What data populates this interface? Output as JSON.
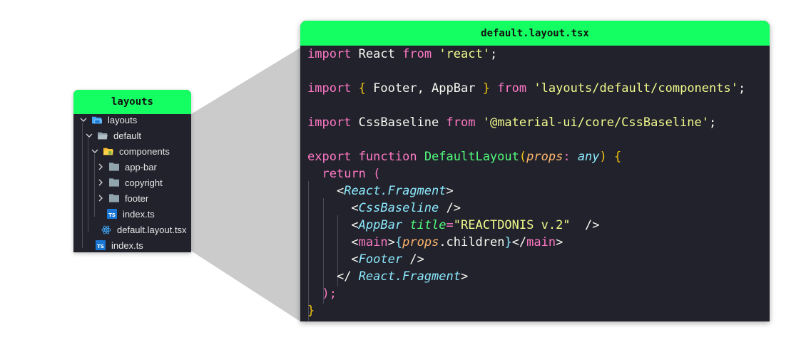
{
  "explorer": {
    "title": "layouts",
    "items": [
      {
        "label": "layouts",
        "chevron": "down",
        "icon": "folder-open-icon"
      },
      {
        "label": "default",
        "chevron": "down",
        "icon": "folder-open-icon"
      },
      {
        "label": "components",
        "chevron": "down",
        "icon": "folder-open-icon"
      },
      {
        "label": "app-bar",
        "chevron": "right",
        "icon": "folder-icon"
      },
      {
        "label": "copyright",
        "chevron": "right",
        "icon": "folder-icon"
      },
      {
        "label": "footer",
        "chevron": "right",
        "icon": "folder-icon"
      },
      {
        "label": "index.ts",
        "chevron": "none",
        "icon": "typescript-file-icon"
      },
      {
        "label": "default.layout.tsx",
        "chevron": "none",
        "icon": "react-file-icon"
      },
      {
        "label": "index.ts",
        "chevron": "none",
        "icon": "typescript-file-icon"
      }
    ]
  },
  "editor": {
    "title": "default.layout.tsx",
    "tokens": {
      "import": "import",
      "from": "from",
      "react_ident": "React",
      "react_str": "'react'",
      "semicolon": ";",
      "lbrace": "{",
      "rbrace": "}",
      "footer_appbar": " Footer, AppBar ",
      "layouts_str": "'layouts/default/components'",
      "cssbaseline_ident": "CssBaseline",
      "cssbaseline_str": "'@material-ui/core/CssBaseline'",
      "export": "export",
      "function": "function",
      "fn_name": "DefaultLayout",
      "lparen": "(",
      "rparen": ")",
      "props": "props",
      "colon": ":",
      "any": "any",
      "return": "return",
      "react_fragment": "React.Fragment",
      "lt": "<",
      "gt": ">",
      "close_self": "/>",
      "close_open": "</",
      "css_baseline_tag": "CssBaseline",
      "appbar_tag": "AppBar",
      "title_attr": "title",
      "eq": "=",
      "title_value": "\"REACTDONIS v.2\"",
      "main": "main",
      "children": ".children",
      "footer_tag": "Footer",
      "close_paren_semi": ");",
      "final_brace": "}"
    }
  },
  "colors": {
    "accent": "#14ff62",
    "editor_bg": "#22222c",
    "explorer_bg": "#21222c",
    "connector": "#cccccc"
  }
}
